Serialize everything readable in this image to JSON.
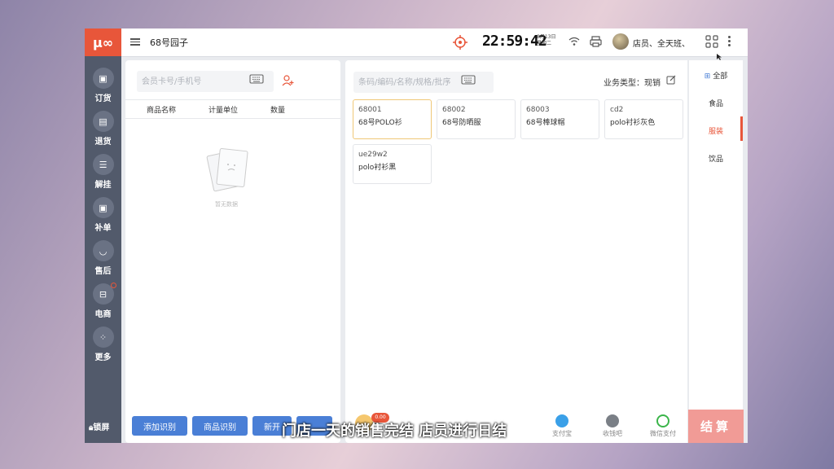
{
  "header": {
    "logo": "µ∞",
    "store_name": "68号园子",
    "time": "22:59:42",
    "date_line1": "8月13日",
    "date_line2": "星期二",
    "staff": "店员、全天班、"
  },
  "sidebar": {
    "items": [
      {
        "label": "订货",
        "icon": "calendar-icon"
      },
      {
        "label": "退货",
        "icon": "box-icon"
      },
      {
        "label": "解挂",
        "icon": "list-icon"
      },
      {
        "label": "补单",
        "icon": "calendar-plus-icon"
      },
      {
        "label": "售后",
        "icon": "service-icon"
      },
      {
        "label": "电商",
        "icon": "shop-icon"
      },
      {
        "label": "更多",
        "icon": "grid-icon"
      }
    ],
    "lock_label": "锁屏"
  },
  "cart": {
    "member_placeholder": "会员卡号/手机号",
    "columns": [
      "商品名称",
      "计量单位",
      "数量"
    ],
    "empty_text": "暂无数据",
    "buttons": [
      "添加识别",
      "商品识别",
      "新开"
    ]
  },
  "products": {
    "search_placeholder": "条码/编码/名称/规格/批序",
    "biz_type": "业务类型：现销",
    "items": [
      {
        "code": "68001",
        "name": "68号POLO衫"
      },
      {
        "code": "68002",
        "name": "68号防晒服"
      },
      {
        "code": "68003",
        "name": "68号棒球帽"
      },
      {
        "code": "cd2",
        "name": "polo衬衫灰色"
      },
      {
        "code": "ue29w2",
        "name": "polo衬衫黑"
      }
    ]
  },
  "categories": [
    "全部",
    "食品",
    "服装",
    "饮品"
  ],
  "payments": [
    "支付宝",
    "收钱吧",
    "微信支付"
  ],
  "amount_badge": "0.00",
  "checkout_label": "结算",
  "subtitle": "门店一天的销售完结   店员进行日结",
  "colors": {
    "brand": "#e8563a",
    "sidebar": "#525a6b",
    "button": "#4a7fd6",
    "checkout": "#f19b96"
  }
}
